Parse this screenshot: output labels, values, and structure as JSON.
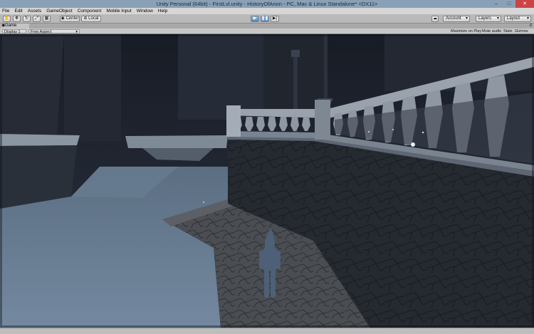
{
  "window": {
    "title": "Unity Personal (64bit) - FirstLvl.unity - HistoryOfAnon - PC, Mac & Linux Standalone* <DX11>"
  },
  "menu": [
    "File",
    "Edit",
    "Assets",
    "GameObject",
    "Component",
    "Mobile Input",
    "Window",
    "Help"
  ],
  "toolbar": {
    "pivot_label": "Center",
    "space_label": "Local",
    "account_label": "Account",
    "layers_label": "Layers",
    "layout_label": "Layout"
  },
  "game_view": {
    "tab_label": "Game",
    "display_label": "Display 1",
    "aspect_label": "Free Aspect",
    "maximize_label": "Maximize on Play",
    "mute_label": "Mute audio",
    "stats_label": "Stats",
    "gizmos_label": "Gizmos"
  },
  "colors": {
    "play_accent": "#4f86c6",
    "scene_sky": "#1c2029",
    "scene_floor": "#6d8196"
  }
}
